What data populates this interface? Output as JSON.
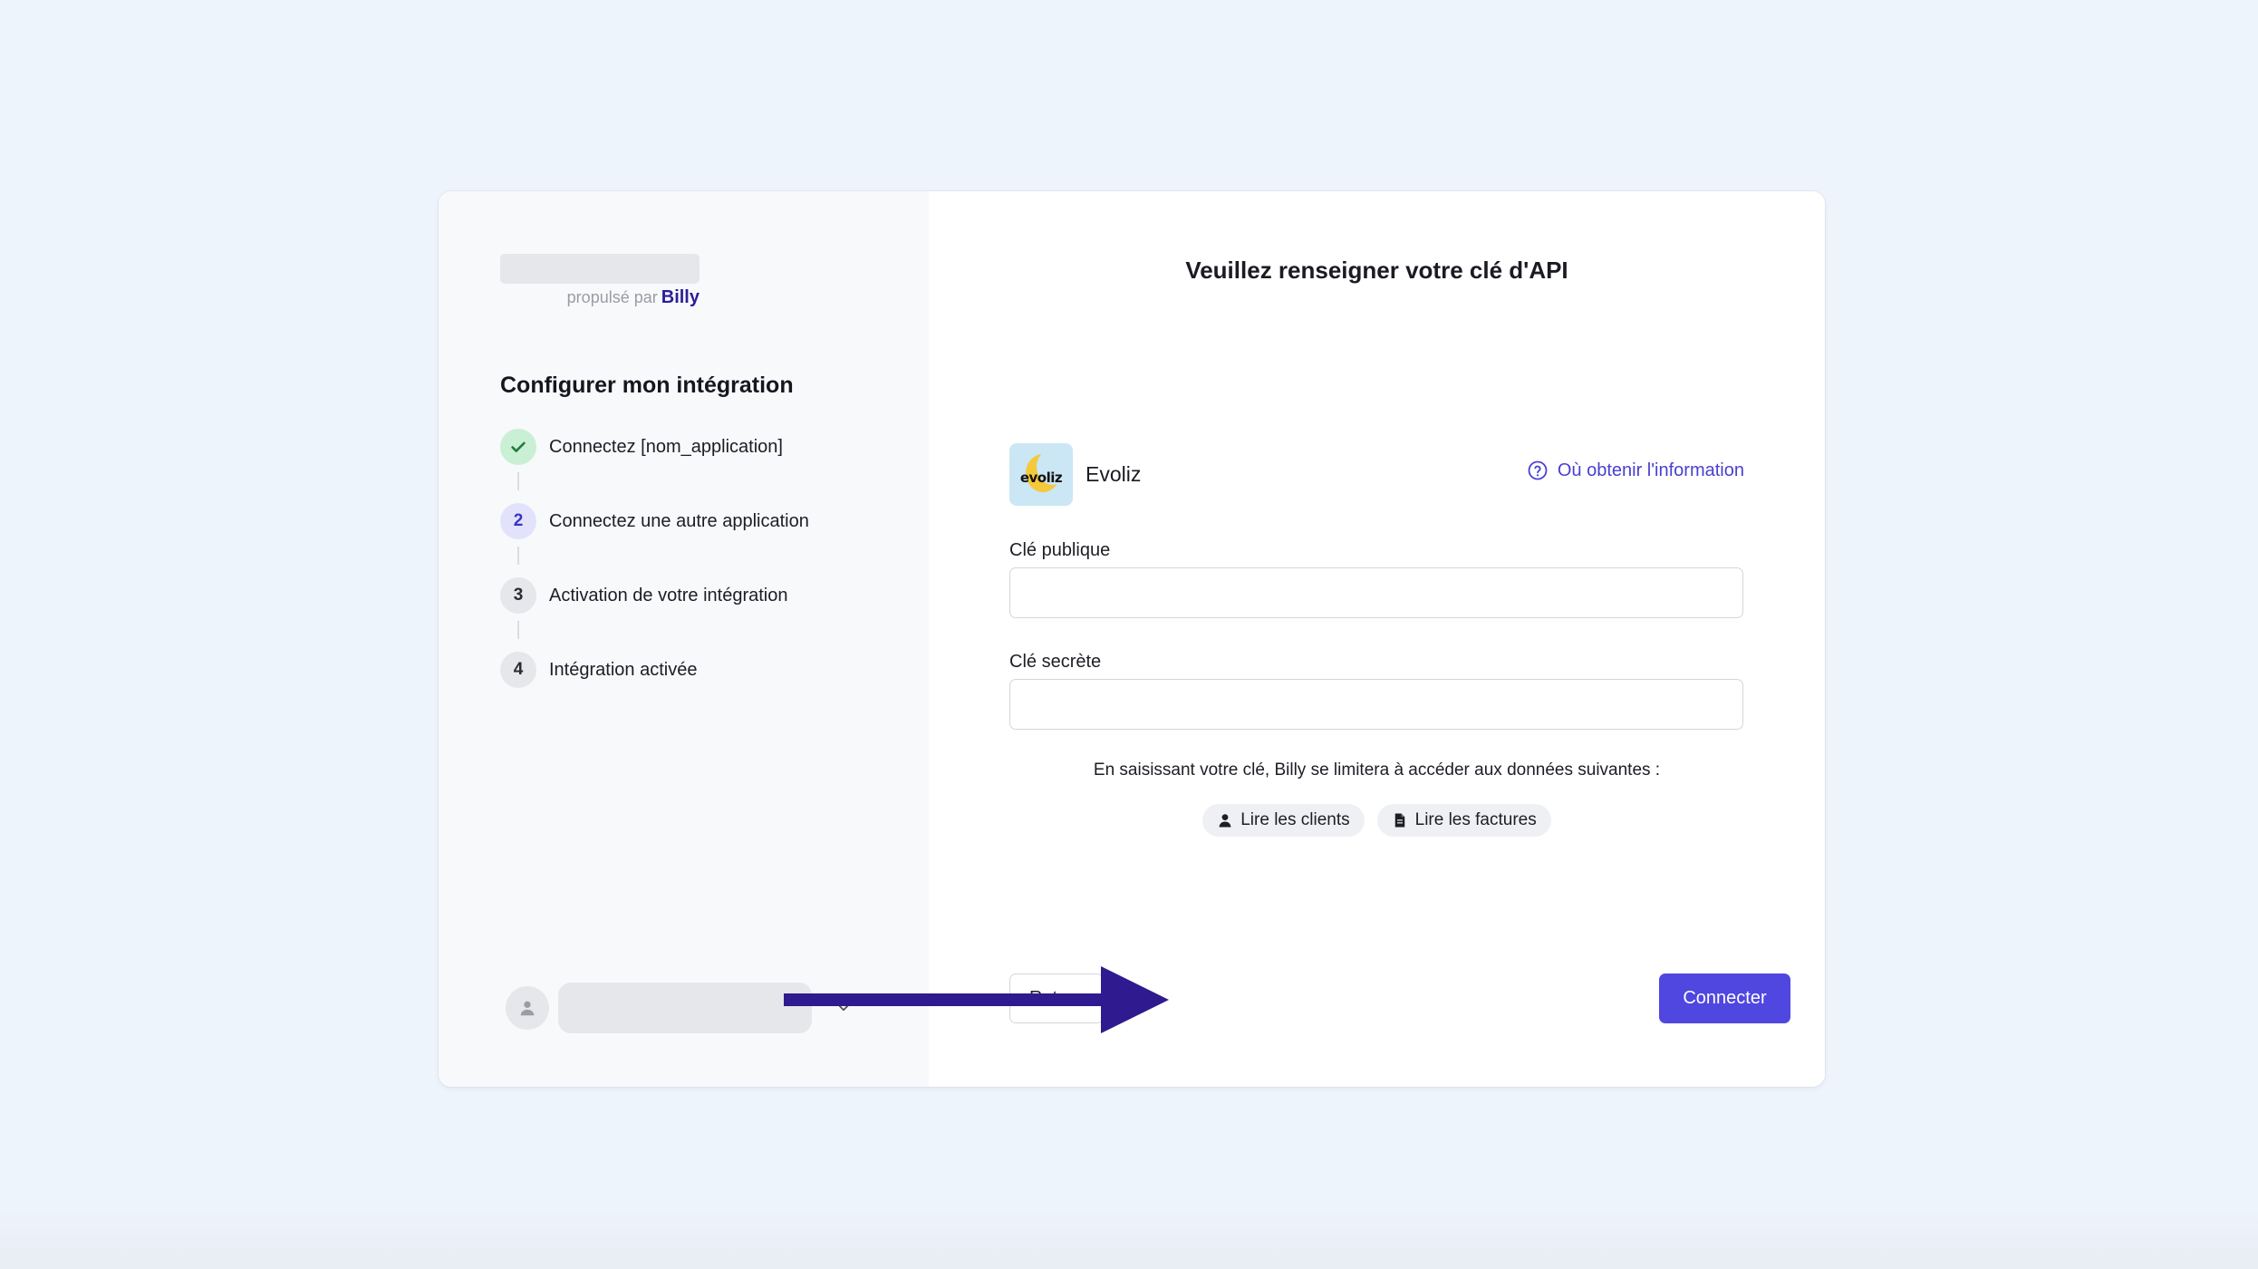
{
  "branding": {
    "powered_by": "propulsé par",
    "brand_name": "Billy"
  },
  "sidebar": {
    "title": "Configurer mon intégration",
    "steps": [
      {
        "number": "",
        "label": "Connectez [nom_application]",
        "state": "done"
      },
      {
        "number": "2",
        "label": "Connectez une autre application",
        "state": "active"
      },
      {
        "number": "3",
        "label": "Activation de votre intégration",
        "state": "pending"
      },
      {
        "number": "4",
        "label": "Intégration activée",
        "state": "pending"
      }
    ],
    "user_icon": "user-icon",
    "user_menu_icon": "chevron-down-icon"
  },
  "main": {
    "title": "Veuillez renseigner votre clé d'API",
    "provider": {
      "name": "Evoliz",
      "logo_text": "evoliz"
    },
    "help_link": "Où obtenir l'information",
    "fields": {
      "public_key_label": "Clé publique",
      "public_key_value": "",
      "secret_key_label": "Clé secrète",
      "secret_key_value": ""
    },
    "notice": "En saisissant votre clé, Billy se limitera à accéder aux données suivantes :",
    "permissions": [
      {
        "icon": "user-icon",
        "label": "Lire les clients"
      },
      {
        "icon": "document-icon",
        "label": "Lire les factures"
      }
    ],
    "back_button": "Retour",
    "connect_button": "Connecter"
  },
  "colors": {
    "accent": "#5046e0",
    "brand": "#2b1e97",
    "annotation_arrow": "#2f1a8f",
    "success_bg": "#c9f0d4",
    "page_bg": "#eef4fc"
  }
}
